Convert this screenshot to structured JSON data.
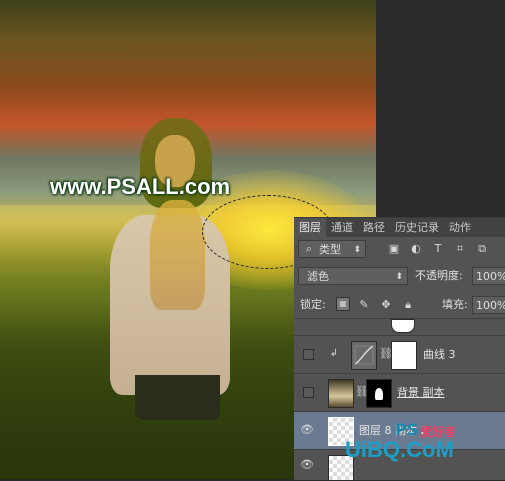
{
  "canvas": {
    "watermark": "www.PSALL.com"
  },
  "panel": {
    "tabs": [
      "图层",
      "通道",
      "路径",
      "历史记录",
      "动作"
    ],
    "filter": {
      "search_icon": "search-icon",
      "type_label": "类型"
    },
    "blend_mode": "滤色",
    "opacity_label": "不透明度:",
    "opacity_value": "100%",
    "lock_label": "锁定:",
    "fill_label": "填充:",
    "fill_value": "100%",
    "layers": [
      {
        "name": "曲线 3",
        "visible": false,
        "kind": "adjustment"
      },
      {
        "name": "背景 副本",
        "visible": false,
        "kind": "masked"
      },
      {
        "name": "图层 8 副本 2",
        "visible": true,
        "kind": "transparent"
      },
      {
        "name": "",
        "visible": true,
        "kind": "transparent"
      }
    ]
  },
  "site_logo": {
    "latin": "UiBQ.CoM",
    "ps_text": "PS",
    "cn_text": "爱好者"
  }
}
